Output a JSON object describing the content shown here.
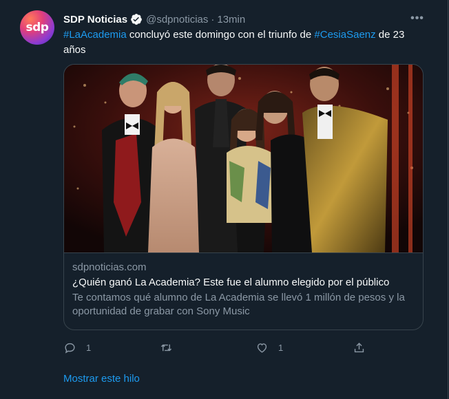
{
  "tweet": {
    "avatar_text": "sdp",
    "author_name": "SDP Noticias",
    "handle": "@sdpnoticias",
    "separator": "·",
    "time": "13min",
    "more_label": "•••",
    "text": {
      "hashtag1": "#LaAcademia",
      "part1": " concluyó este domingo con el triunfo de ",
      "hashtag2": "#CesiaSaenz",
      "part2": " de 23 años"
    }
  },
  "card": {
    "domain": "sdpnoticias.com",
    "title": "¿Quién ganó La Academia? Este fue el alumno elegido por el público",
    "description": "Te contamos qué alumno de La Academia se llevó 1 millón de pesos y la oportunidad de grabar con Sony Music"
  },
  "actions": {
    "reply_count": "1",
    "retweet_count": "",
    "like_count": "1"
  },
  "show_thread_label": "Mostrar este hilo",
  "colors": {
    "background": "#15202b",
    "accent": "#1d9bf0",
    "muted": "#8b98a5",
    "border": "#38444d"
  }
}
